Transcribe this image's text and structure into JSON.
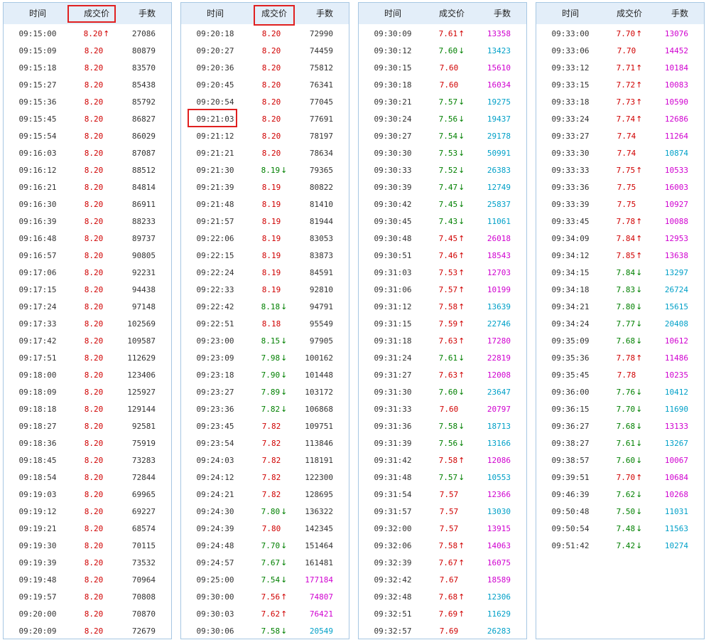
{
  "headers": {
    "time": "时间",
    "price": "成交价",
    "volume": "手数"
  },
  "colors": {
    "up": "#d00000",
    "down": "#008000",
    "mag": "#d000d0",
    "cyan": "#00a0c8",
    "neutral": "#333333",
    "highlight": "#e02020"
  },
  "panels": [
    [
      [
        "09:15:00",
        "8.20",
        "u",
        "27086",
        "n"
      ],
      [
        "09:15:09",
        "8.20",
        "",
        "80879",
        "n"
      ],
      [
        "09:15:18",
        "8.20",
        "",
        "83570",
        "n"
      ],
      [
        "09:15:27",
        "8.20",
        "",
        "85438",
        "n"
      ],
      [
        "09:15:36",
        "8.20",
        "",
        "85792",
        "n"
      ],
      [
        "09:15:45",
        "8.20",
        "",
        "86827",
        "n"
      ],
      [
        "09:15:54",
        "8.20",
        "",
        "86029",
        "n"
      ],
      [
        "09:16:03",
        "8.20",
        "",
        "87087",
        "n"
      ],
      [
        "09:16:12",
        "8.20",
        "",
        "88512",
        "n"
      ],
      [
        "09:16:21",
        "8.20",
        "",
        "84814",
        "n"
      ],
      [
        "09:16:30",
        "8.20",
        "",
        "86911",
        "n"
      ],
      [
        "09:16:39",
        "8.20",
        "",
        "88233",
        "n"
      ],
      [
        "09:16:48",
        "8.20",
        "",
        "89737",
        "n"
      ],
      [
        "09:16:57",
        "8.20",
        "",
        "90805",
        "n"
      ],
      [
        "09:17:06",
        "8.20",
        "",
        "92231",
        "n"
      ],
      [
        "09:17:15",
        "8.20",
        "",
        "94438",
        "n"
      ],
      [
        "09:17:24",
        "8.20",
        "",
        "97148",
        "n"
      ],
      [
        "09:17:33",
        "8.20",
        "",
        "102569",
        "n"
      ],
      [
        "09:17:42",
        "8.20",
        "",
        "109587",
        "n"
      ],
      [
        "09:17:51",
        "8.20",
        "",
        "112629",
        "n"
      ],
      [
        "09:18:00",
        "8.20",
        "",
        "123406",
        "n"
      ],
      [
        "09:18:09",
        "8.20",
        "",
        "125927",
        "n"
      ],
      [
        "09:18:18",
        "8.20",
        "",
        "129144",
        "n"
      ],
      [
        "09:18:27",
        "8.20",
        "",
        "92581",
        "n"
      ],
      [
        "09:18:36",
        "8.20",
        "",
        "75919",
        "n"
      ],
      [
        "09:18:45",
        "8.20",
        "",
        "73283",
        "n"
      ],
      [
        "09:18:54",
        "8.20",
        "",
        "72844",
        "n"
      ],
      [
        "09:19:03",
        "8.20",
        "",
        "69965",
        "n"
      ],
      [
        "09:19:12",
        "8.20",
        "",
        "69227",
        "n"
      ],
      [
        "09:19:21",
        "8.20",
        "",
        "68574",
        "n"
      ],
      [
        "09:19:30",
        "8.20",
        "",
        "70115",
        "n"
      ],
      [
        "09:19:39",
        "8.20",
        "",
        "73532",
        "n"
      ],
      [
        "09:19:48",
        "8.20",
        "",
        "70964",
        "n"
      ],
      [
        "09:19:57",
        "8.20",
        "",
        "70808",
        "n"
      ],
      [
        "09:20:00",
        "8.20",
        "",
        "70870",
        "n"
      ],
      [
        "09:20:09",
        "8.20",
        "",
        "72679",
        "n"
      ]
    ],
    [
      [
        "09:20:18",
        "8.20",
        "",
        "72990",
        "n"
      ],
      [
        "09:20:27",
        "8.20",
        "",
        "74459",
        "n"
      ],
      [
        "09:20:36",
        "8.20",
        "",
        "75812",
        "n"
      ],
      [
        "09:20:45",
        "8.20",
        "",
        "76341",
        "n"
      ],
      [
        "09:20:54",
        "8.20",
        "",
        "77045",
        "n"
      ],
      [
        "09:21:03",
        "8.20",
        "",
        "77691",
        "n"
      ],
      [
        "09:21:12",
        "8.20",
        "",
        "78197",
        "n"
      ],
      [
        "09:21:21",
        "8.20",
        "",
        "78634",
        "n"
      ],
      [
        "09:21:30",
        "8.19",
        "d",
        "79365",
        "n"
      ],
      [
        "09:21:39",
        "8.19",
        "",
        "80822",
        "n"
      ],
      [
        "09:21:48",
        "8.19",
        "",
        "81410",
        "n"
      ],
      [
        "09:21:57",
        "8.19",
        "",
        "81944",
        "n"
      ],
      [
        "09:22:06",
        "8.19",
        "",
        "83053",
        "n"
      ],
      [
        "09:22:15",
        "8.19",
        "",
        "83873",
        "n"
      ],
      [
        "09:22:24",
        "8.19",
        "",
        "84591",
        "n"
      ],
      [
        "09:22:33",
        "8.19",
        "",
        "92810",
        "n"
      ],
      [
        "09:22:42",
        "8.18",
        "d",
        "94791",
        "n"
      ],
      [
        "09:22:51",
        "8.18",
        "",
        "95549",
        "n"
      ],
      [
        "09:23:00",
        "8.15",
        "d",
        "97905",
        "n"
      ],
      [
        "09:23:09",
        "7.98",
        "d",
        "100162",
        "n"
      ],
      [
        "09:23:18",
        "7.90",
        "d",
        "101448",
        "n"
      ],
      [
        "09:23:27",
        "7.89",
        "d",
        "103172",
        "n"
      ],
      [
        "09:23:36",
        "7.82",
        "d",
        "106868",
        "n"
      ],
      [
        "09:23:45",
        "7.82",
        "",
        "109751",
        "n"
      ],
      [
        "09:23:54",
        "7.82",
        "",
        "113846",
        "n"
      ],
      [
        "09:24:03",
        "7.82",
        "",
        "118191",
        "n"
      ],
      [
        "09:24:12",
        "7.82",
        "",
        "122300",
        "n"
      ],
      [
        "09:24:21",
        "7.82",
        "",
        "128695",
        "n"
      ],
      [
        "09:24:30",
        "7.80",
        "d",
        "136322",
        "n"
      ],
      [
        "09:24:39",
        "7.80",
        "",
        "142345",
        "n"
      ],
      [
        "09:24:48",
        "7.70",
        "d",
        "151464",
        "n"
      ],
      [
        "09:24:57",
        "7.67",
        "d",
        "161481",
        "n"
      ],
      [
        "09:25:00",
        "7.54",
        "d",
        "177184",
        "m"
      ],
      [
        "09:30:00",
        "7.56",
        "u",
        "74807",
        "m"
      ],
      [
        "09:30:03",
        "7.62",
        "u",
        "76421",
        "m"
      ],
      [
        "09:30:06",
        "7.58",
        "d",
        "20549",
        "c"
      ]
    ],
    [
      [
        "09:30:09",
        "7.61",
        "u",
        "13358",
        "m"
      ],
      [
        "09:30:12",
        "7.60",
        "d",
        "13423",
        "c"
      ],
      [
        "09:30:15",
        "7.60",
        "",
        "15610",
        "m"
      ],
      [
        "09:30:18",
        "7.60",
        "",
        "16034",
        "m"
      ],
      [
        "09:30:21",
        "7.57",
        "d",
        "19275",
        "c"
      ],
      [
        "09:30:24",
        "7.56",
        "d",
        "19437",
        "c"
      ],
      [
        "09:30:27",
        "7.54",
        "d",
        "29178",
        "c"
      ],
      [
        "09:30:30",
        "7.53",
        "d",
        "50991",
        "c"
      ],
      [
        "09:30:33",
        "7.52",
        "d",
        "26383",
        "c"
      ],
      [
        "09:30:39",
        "7.47",
        "d",
        "12749",
        "c"
      ],
      [
        "09:30:42",
        "7.45",
        "d",
        "25837",
        "c"
      ],
      [
        "09:30:45",
        "7.43",
        "d",
        "11061",
        "c"
      ],
      [
        "09:30:48",
        "7.45",
        "u",
        "26018",
        "m"
      ],
      [
        "09:30:51",
        "7.46",
        "u",
        "18543",
        "m"
      ],
      [
        "09:31:03",
        "7.53",
        "u",
        "12703",
        "m"
      ],
      [
        "09:31:06",
        "7.57",
        "u",
        "10199",
        "m"
      ],
      [
        "09:31:12",
        "7.58",
        "u",
        "13639",
        "c"
      ],
      [
        "09:31:15",
        "7.59",
        "u",
        "22746",
        "c"
      ],
      [
        "09:31:18",
        "7.63",
        "u",
        "17280",
        "m"
      ],
      [
        "09:31:24",
        "7.61",
        "d",
        "22819",
        "m"
      ],
      [
        "09:31:27",
        "7.63",
        "u",
        "12008",
        "m"
      ],
      [
        "09:31:30",
        "7.60",
        "d",
        "23647",
        "c"
      ],
      [
        "09:31:33",
        "7.60",
        "",
        "20797",
        "m"
      ],
      [
        "09:31:36",
        "7.58",
        "d",
        "18713",
        "c"
      ],
      [
        "09:31:39",
        "7.56",
        "d",
        "13166",
        "c"
      ],
      [
        "09:31:42",
        "7.58",
        "u",
        "12086",
        "m"
      ],
      [
        "09:31:48",
        "7.57",
        "d",
        "10553",
        "c"
      ],
      [
        "09:31:54",
        "7.57",
        "",
        "12366",
        "m"
      ],
      [
        "09:31:57",
        "7.57",
        "",
        "13030",
        "c"
      ],
      [
        "09:32:00",
        "7.57",
        "",
        "13915",
        "m"
      ],
      [
        "09:32:06",
        "7.58",
        "u",
        "14063",
        "m"
      ],
      [
        "09:32:39",
        "7.67",
        "u",
        "16075",
        "m"
      ],
      [
        "09:32:42",
        "7.67",
        "",
        "18589",
        "m"
      ],
      [
        "09:32:48",
        "7.68",
        "u",
        "12306",
        "c"
      ],
      [
        "09:32:51",
        "7.69",
        "u",
        "11629",
        "c"
      ],
      [
        "09:32:57",
        "7.69",
        "",
        "26283",
        "c"
      ]
    ],
    [
      [
        "09:33:00",
        "7.70",
        "u",
        "13076",
        "m"
      ],
      [
        "09:33:06",
        "7.70",
        "",
        "14452",
        "m"
      ],
      [
        "09:33:12",
        "7.71",
        "u",
        "10184",
        "m"
      ],
      [
        "09:33:15",
        "7.72",
        "u",
        "10083",
        "m"
      ],
      [
        "09:33:18",
        "7.73",
        "u",
        "10590",
        "m"
      ],
      [
        "09:33:24",
        "7.74",
        "u",
        "12686",
        "m"
      ],
      [
        "09:33:27",
        "7.74",
        "",
        "11264",
        "m"
      ],
      [
        "09:33:30",
        "7.74",
        "",
        "10874",
        "c"
      ],
      [
        "09:33:33",
        "7.75",
        "u",
        "10533",
        "m"
      ],
      [
        "09:33:36",
        "7.75",
        "",
        "16003",
        "m"
      ],
      [
        "09:33:39",
        "7.75",
        "",
        "10927",
        "m"
      ],
      [
        "09:33:45",
        "7.78",
        "u",
        "10088",
        "m"
      ],
      [
        "09:34:09",
        "7.84",
        "u",
        "12953",
        "m"
      ],
      [
        "09:34:12",
        "7.85",
        "u",
        "13638",
        "m"
      ],
      [
        "09:34:15",
        "7.84",
        "d",
        "13297",
        "c"
      ],
      [
        "09:34:18",
        "7.83",
        "d",
        "26724",
        "c"
      ],
      [
        "09:34:21",
        "7.80",
        "d",
        "15615",
        "c"
      ],
      [
        "09:34:24",
        "7.77",
        "d",
        "20408",
        "c"
      ],
      [
        "09:35:09",
        "7.68",
        "d",
        "10612",
        "m"
      ],
      [
        "09:35:36",
        "7.78",
        "u",
        "11486",
        "m"
      ],
      [
        "09:35:45",
        "7.78",
        "",
        "10235",
        "m"
      ],
      [
        "09:36:00",
        "7.76",
        "d",
        "10412",
        "c"
      ],
      [
        "09:36:15",
        "7.70",
        "d",
        "11690",
        "c"
      ],
      [
        "09:36:27",
        "7.68",
        "d",
        "13133",
        "m"
      ],
      [
        "09:38:27",
        "7.61",
        "d",
        "13267",
        "c"
      ],
      [
        "09:38:57",
        "7.60",
        "d",
        "10067",
        "m"
      ],
      [
        "09:39:51",
        "7.70",
        "u",
        "10684",
        "m"
      ],
      [
        "09:46:39",
        "7.62",
        "d",
        "10268",
        "m"
      ],
      [
        "09:50:48",
        "7.50",
        "d",
        "11031",
        "c"
      ],
      [
        "09:50:54",
        "7.48",
        "d",
        "11563",
        "c"
      ],
      [
        "09:51:42",
        "7.42",
        "d",
        "10274",
        "c"
      ]
    ]
  ]
}
